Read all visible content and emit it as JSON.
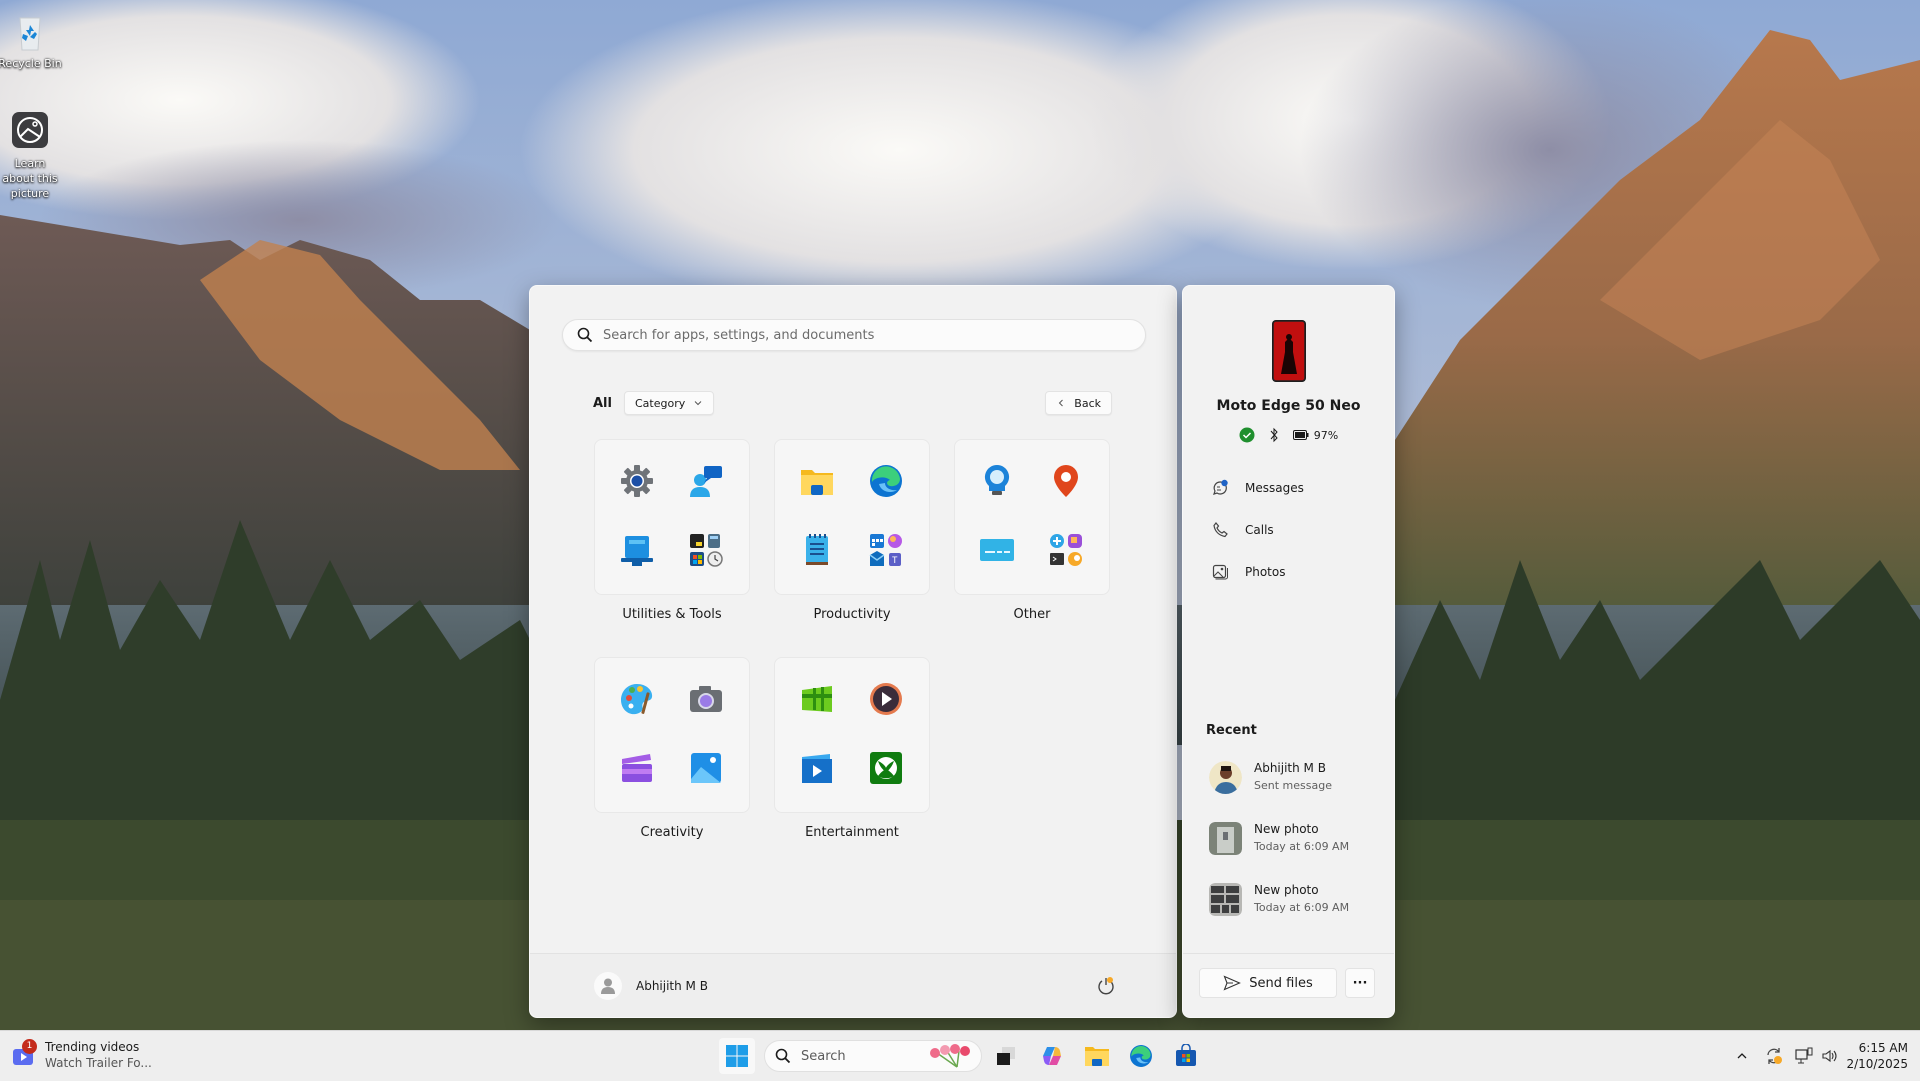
{
  "desktop": {
    "icons": [
      {
        "label": "Recycle Bin",
        "icon": "recycle-bin-icon"
      },
      {
        "label": "Learn about this picture",
        "icon": "learn-about-picture-icon"
      }
    ]
  },
  "start_menu": {
    "search": {
      "placeholder": "Search for apps, settings, and documents",
      "icon": "search-icon"
    },
    "filters": {
      "all_label": "All",
      "category_label": "Category",
      "back_label": "Back"
    },
    "categories": [
      {
        "label": "Utilities & Tools",
        "apps": [
          "settings-icon",
          "get-help-icon",
          "windows-backup-icon",
          "utilities-folder-icon"
        ]
      },
      {
        "label": "Productivity",
        "apps": [
          "file-explorer-icon",
          "edge-icon",
          "notepad-icon",
          "productivity-folder-icon"
        ]
      },
      {
        "label": "Other",
        "apps": [
          "tips-icon",
          "maps-icon",
          "live-captions-icon",
          "other-folder-icon"
        ]
      },
      {
        "label": "Creativity",
        "apps": [
          "paint-icon",
          "camera-icon",
          "clipchamp-icon",
          "photos-icon"
        ]
      },
      {
        "label": "Entertainment",
        "apps": [
          "movies-tv-icon",
          "media-player-icon",
          "video-editor-icon",
          "xbox-icon"
        ]
      }
    ],
    "footer": {
      "user_name": "Abhijith M B",
      "power_icon": "power-icon"
    }
  },
  "phone_link": {
    "device_name": "Moto Edge 50 Neo",
    "status": {
      "connected": true,
      "bluetooth": true,
      "battery": "97%"
    },
    "links": [
      {
        "label": "Messages",
        "icon": "messages-icon"
      },
      {
        "label": "Calls",
        "icon": "phone-icon"
      },
      {
        "label": "Photos",
        "icon": "photos-icon"
      }
    ],
    "recent_heading": "Recent",
    "recent": [
      {
        "title": "Abhijith M B",
        "subtitle": "Sent message"
      },
      {
        "title": "New photo",
        "subtitle": "Today at 6:09 AM"
      },
      {
        "title": "New photo",
        "subtitle": "Today at 6:09 AM"
      }
    ],
    "send_files_label": "Send files",
    "more_label": "···"
  },
  "taskbar": {
    "widget": {
      "badge": "1",
      "title": "Trending videos",
      "subtitle": "Watch Trailer Fo..."
    },
    "search_placeholder": "Search",
    "pinned": [
      "start-icon",
      "task-view-icon",
      "copilot-icon",
      "file-explorer-icon",
      "edge-icon",
      "microsoft-store-icon"
    ],
    "tray": [
      "chevron-up-icon",
      "sync-icon",
      "network-icon",
      "volume-icon"
    ],
    "clock": {
      "time": "6:15 AM",
      "date": "2/10/2025"
    }
  }
}
